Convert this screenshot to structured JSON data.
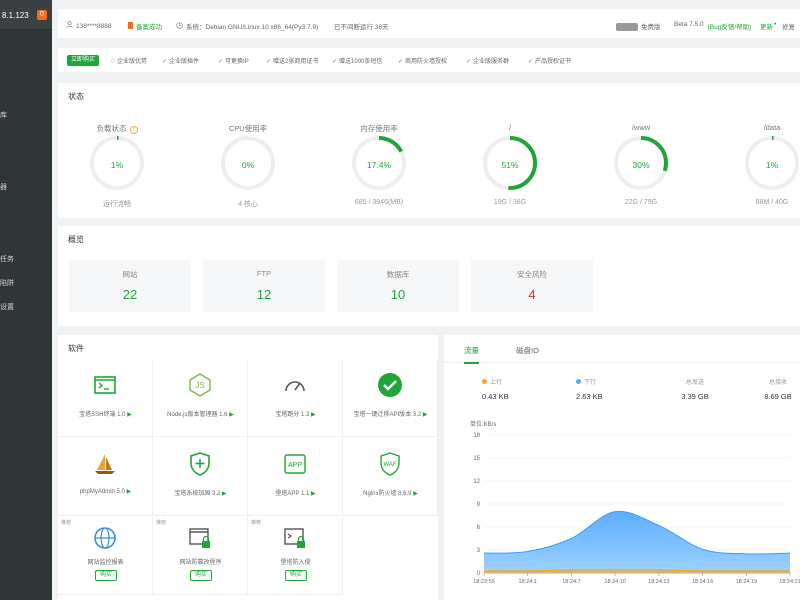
{
  "sidebar": {
    "ip": "8.1.123",
    "badge": "0",
    "items": [
      "库",
      "器",
      "任务",
      "陷阱",
      "设置"
    ]
  },
  "topbar": {
    "user": "138****8888",
    "cert": "备案成功",
    "system": "系统：Debian GNU/Linux 10 x86_64(Py3.7.9)",
    "uptime": "已不间断运行 38天",
    "edition": "免费版",
    "version": "Beta 7.5.0",
    "bug_link": "[Bug反馈/帮助]",
    "update": "更新",
    "repair": "修复"
  },
  "features": {
    "buy_label": "立即购买",
    "enterprise_label": "企业版优势",
    "items": [
      "企业版插件",
      "可更换IP",
      "赠送2张商用证书",
      "赠送1000条短信",
      "商用防火墙授权",
      "企业版服务群",
      "产品授权证书"
    ]
  },
  "status": {
    "title": "状态",
    "gauges": [
      {
        "label": "负载状态",
        "value": "1%",
        "sub": "运行流畅",
        "percent": 1,
        "help": true
      },
      {
        "label": "CPU使用率",
        "value": "0%",
        "sub": "4 核心",
        "percent": 0
      },
      {
        "label": "内存使用率",
        "value": "17.4%",
        "sub": "685 / 3946(MB)",
        "percent": 17.4
      },
      {
        "label": "/",
        "value": "51%",
        "sub": "19G / 38G",
        "percent": 51
      },
      {
        "label": "/www",
        "value": "30%",
        "sub": "22G / 79G",
        "percent": 30
      },
      {
        "label": "/data",
        "value": "1%",
        "sub": "88M / 40G",
        "percent": 1
      }
    ]
  },
  "overview": {
    "title": "概览",
    "cards": [
      {
        "label": "网站",
        "value": "22",
        "color": "#20a53a"
      },
      {
        "label": "FTP",
        "value": "12",
        "color": "#20a53a"
      },
      {
        "label": "数据库",
        "value": "10",
        "color": "#20a53a"
      },
      {
        "label": "安全风险",
        "value": "4",
        "color": "#d9303a"
      }
    ]
  },
  "software": {
    "title": "软件",
    "items": [
      {
        "name": "宝塔SSH终端 1.0",
        "icon": "terminal-icon"
      },
      {
        "name": "Node.js版本管理器 1.6",
        "icon": "nodejs-icon"
      },
      {
        "name": "宝塔跑分 1.3",
        "icon": "speedometer-icon"
      },
      {
        "name": "宝塔一键迁移API版本 3.2",
        "icon": "check-circle-icon"
      },
      {
        "name": "phpMyAdmin 5.0",
        "icon": "sailboat-icon"
      },
      {
        "name": "宝塔系统加固 3.2",
        "icon": "shield-plus-icon"
      },
      {
        "name": "堡塔APP 1.1",
        "icon": "app-icon"
      },
      {
        "name": "Nginx防火墙 8.6.9",
        "icon": "waf-icon"
      },
      {
        "name": "网站监控报表",
        "icon": "globe-icon",
        "tag": "推荐",
        "buy": "购买"
      },
      {
        "name": "网站防篡改程序",
        "icon": "lock-window-icon",
        "tag": "推荐",
        "buy": "购买"
      },
      {
        "name": "堡塔防入侵",
        "icon": "terminal-lock-icon",
        "tag": "推荐",
        "buy": "购买"
      }
    ]
  },
  "traffic": {
    "tabs": [
      "流量",
      "磁盘IO"
    ],
    "stats": [
      {
        "label": "上行",
        "value": "0.43 KB",
        "color": "#f5a623"
      },
      {
        "label": "下行",
        "value": "2.63 KB",
        "color": "#52a9ff"
      },
      {
        "label": "总发送",
        "value": "3.39 GB"
      },
      {
        "label": "总接收",
        "value": "8.69 GB"
      }
    ],
    "unit_label": "单位:KB/s"
  },
  "chart_data": {
    "type": "area",
    "ylabel": "单位:KB/s",
    "ylim": [
      0,
      18
    ],
    "yticks": [
      0,
      3,
      6,
      9,
      12,
      15,
      18
    ],
    "x": [
      "18:23:59",
      "18:24:1",
      "18:24:7",
      "18:24:10",
      "18:24:13",
      "18:24:16",
      "18:24:19",
      "18:24:21"
    ],
    "series": [
      {
        "name": "上行",
        "color": "#f5a623",
        "values": [
          0.3,
          0.3,
          0.4,
          0.4,
          0.4,
          0.3,
          0.3,
          0.3
        ]
      },
      {
        "name": "下行",
        "color": "#52a9ff",
        "values": [
          2.6,
          2.8,
          4.5,
          8.0,
          6.2,
          3.1,
          2.5,
          2.6
        ]
      }
    ]
  }
}
